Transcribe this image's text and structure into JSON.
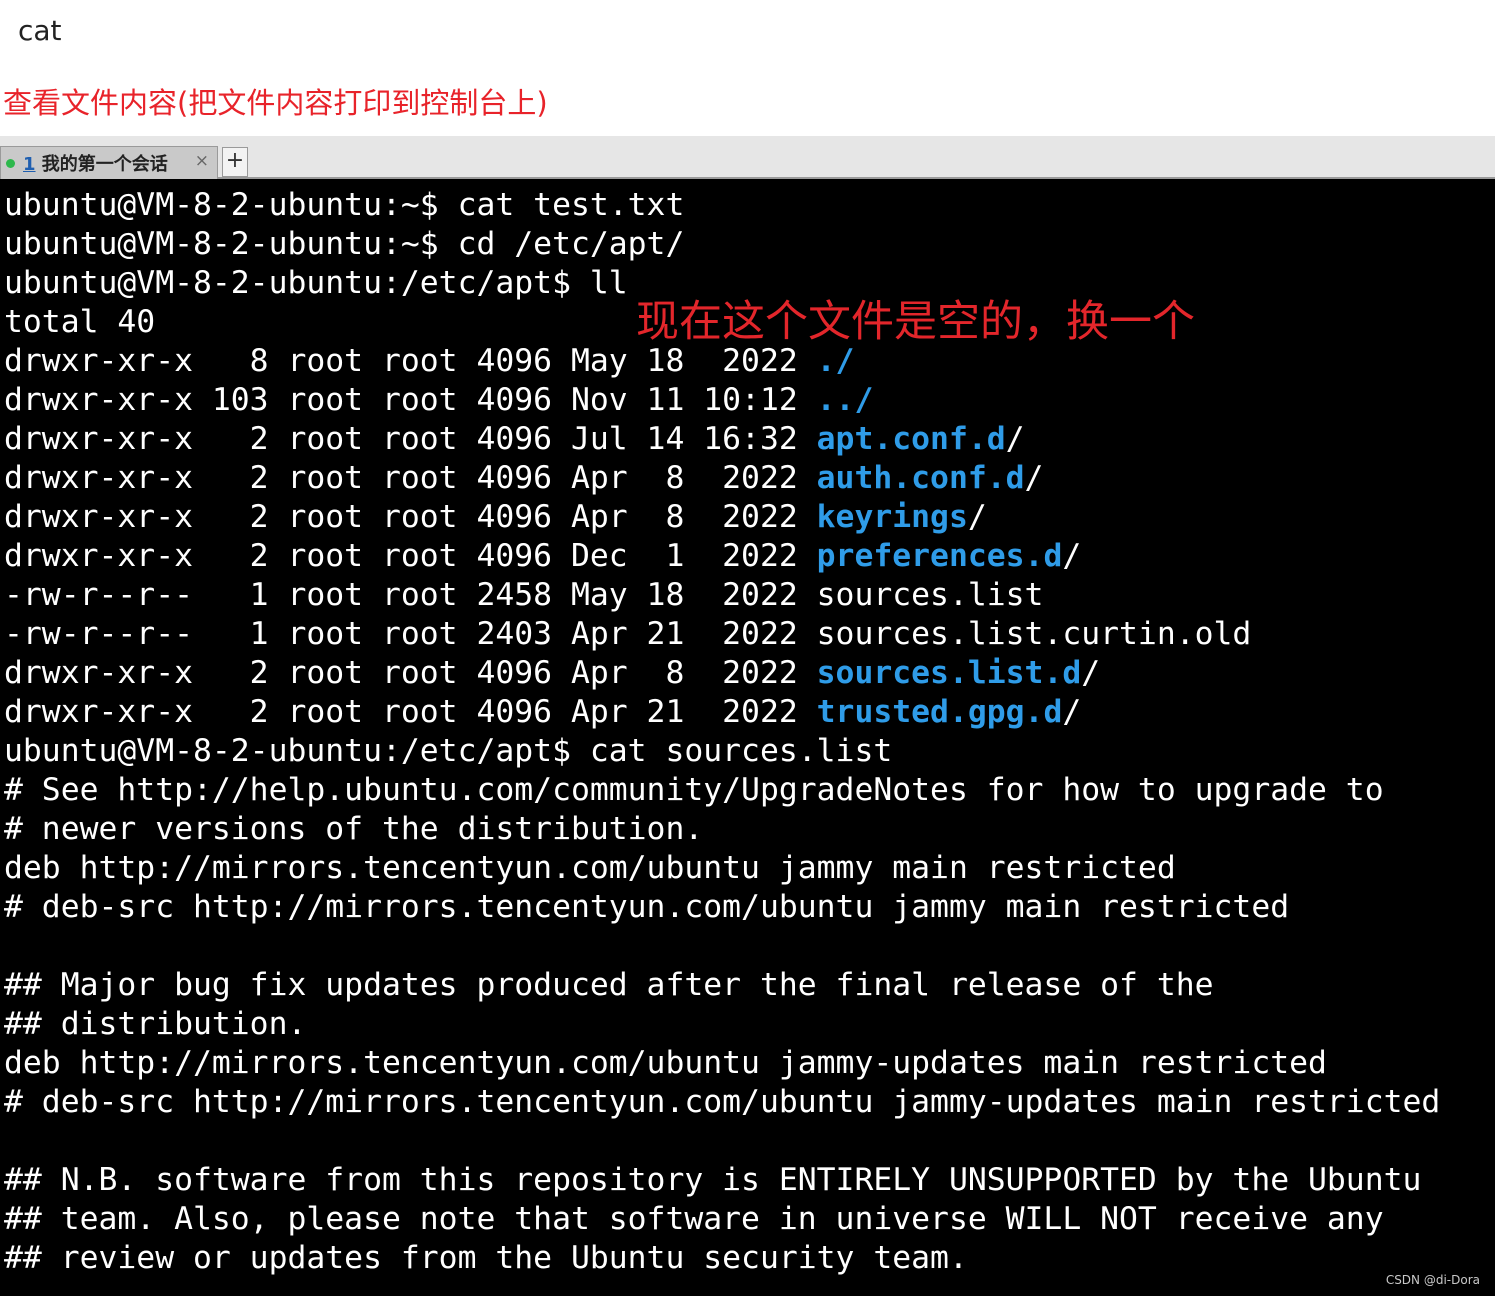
{
  "doc": {
    "heading": "cat",
    "description": "查看文件内容(把文件内容打印到控制台上)"
  },
  "tabbar": {
    "tab_number": "1",
    "tab_title": " 我的第一个会话",
    "close_glyph": "×",
    "new_tab_glyph": "+"
  },
  "terminal": {
    "lines": [
      [
        {
          "t": "ubuntu@VM-8-2-ubuntu:~$ cat test.txt"
        }
      ],
      [
        {
          "t": "ubuntu@VM-8-2-ubuntu:~$ cd /etc/apt/"
        }
      ],
      [
        {
          "t": "ubuntu@VM-8-2-ubuntu:/etc/apt$ ll"
        }
      ],
      [
        {
          "t": "total 40"
        }
      ],
      [
        {
          "t": "drwxr-xr-x   8 root root 4096 May 18  2022 "
        },
        {
          "t": "./",
          "c": "dir"
        }
      ],
      [
        {
          "t": "drwxr-xr-x 103 root root 4096 Nov 11 10:12 "
        },
        {
          "t": "../",
          "c": "dir"
        }
      ],
      [
        {
          "t": "drwxr-xr-x   2 root root 4096 Jul 14 16:32 "
        },
        {
          "t": "apt.conf.d",
          "c": "dir"
        },
        {
          "t": "/"
        }
      ],
      [
        {
          "t": "drwxr-xr-x   2 root root 4096 Apr  8  2022 "
        },
        {
          "t": "auth.conf.d",
          "c": "dir"
        },
        {
          "t": "/"
        }
      ],
      [
        {
          "t": "drwxr-xr-x   2 root root 4096 Apr  8  2022 "
        },
        {
          "t": "keyrings",
          "c": "dir"
        },
        {
          "t": "/"
        }
      ],
      [
        {
          "t": "drwxr-xr-x   2 root root 4096 Dec  1  2022 "
        },
        {
          "t": "preferences.d",
          "c": "dir"
        },
        {
          "t": "/"
        }
      ],
      [
        {
          "t": "-rw-r--r--   1 root root 2458 May 18  2022 sources.list"
        }
      ],
      [
        {
          "t": "-rw-r--r--   1 root root 2403 Apr 21  2022 sources.list.curtin.old"
        }
      ],
      [
        {
          "t": "drwxr-xr-x   2 root root 4096 Apr  8  2022 "
        },
        {
          "t": "sources.list.d",
          "c": "dir"
        },
        {
          "t": "/"
        }
      ],
      [
        {
          "t": "drwxr-xr-x   2 root root 4096 Apr 21  2022 "
        },
        {
          "t": "trusted.gpg.d",
          "c": "dir"
        },
        {
          "t": "/"
        }
      ],
      [
        {
          "t": "ubuntu@VM-8-2-ubuntu:/etc/apt$ cat sources.list"
        }
      ],
      [
        {
          "t": "# See http://help.ubuntu.com/community/UpgradeNotes for how to upgrade to"
        }
      ],
      [
        {
          "t": "# newer versions of the distribution."
        }
      ],
      [
        {
          "t": "deb http://mirrors.tencentyun.com/ubuntu jammy main restricted"
        }
      ],
      [
        {
          "t": "# deb-src http://mirrors.tencentyun.com/ubuntu jammy main restricted"
        }
      ],
      [
        {
          "t": ""
        }
      ],
      [
        {
          "t": "## Major bug fix updates produced after the final release of the"
        }
      ],
      [
        {
          "t": "## distribution."
        }
      ],
      [
        {
          "t": "deb http://mirrors.tencentyun.com/ubuntu jammy-updates main restricted"
        }
      ],
      [
        {
          "t": "# deb-src http://mirrors.tencentyun.com/ubuntu jammy-updates main restricted"
        }
      ],
      [
        {
          "t": ""
        }
      ],
      [
        {
          "t": "## N.B. software from this repository is ENTIRELY UNSUPPORTED by the Ubuntu"
        }
      ],
      [
        {
          "t": "## team. Also, please note that software in universe WILL NOT receive any"
        }
      ],
      [
        {
          "t": "## review or updates from the Ubuntu security team."
        }
      ]
    ],
    "annotation": "现在这个文件是空的，换一个",
    "directory_color": "#2f9ce8",
    "text_color": "#ffffff",
    "background_color": "#000000"
  },
  "watermark": "CSDN @di-Dora"
}
